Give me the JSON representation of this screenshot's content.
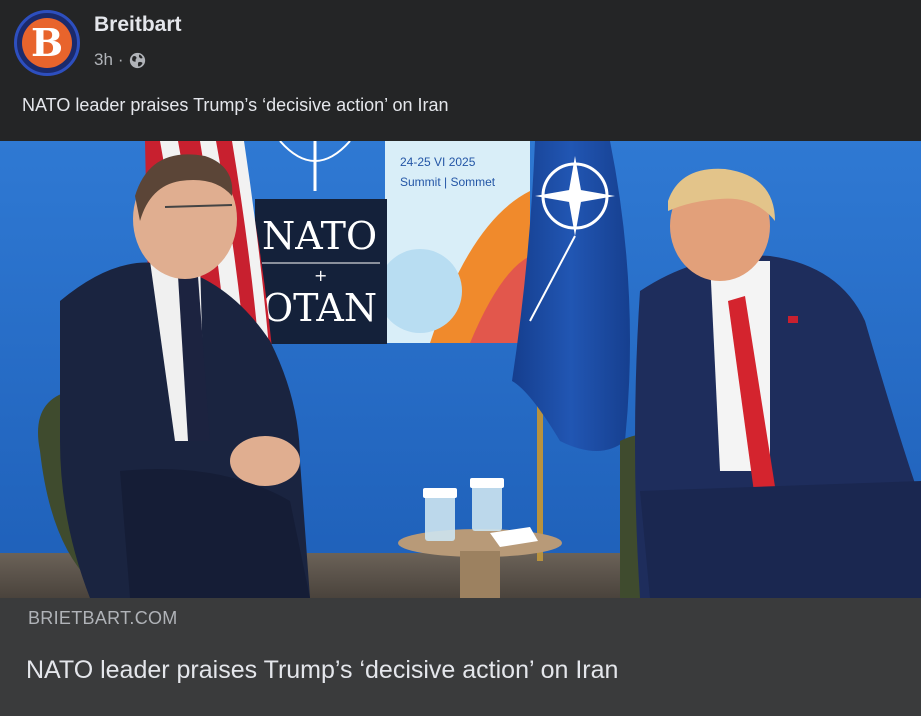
{
  "post": {
    "page_name": "Breitbart",
    "avatar_letter": "B",
    "time": "3h",
    "separator": "·",
    "audience_icon": "globe-icon",
    "caption": "NATO leader praises Trump’s ‘decisive action’ on Iran"
  },
  "photo": {
    "backdrop_text": {
      "dates": "24-25 VI 2025",
      "summit": "Summit | Sommet",
      "nato": "NATO",
      "otan": "OTAN",
      "plus": "+"
    }
  },
  "link_preview": {
    "domain": "BRIETBART.COM",
    "title": "NATO leader praises Trump’s ‘decisive action’ on Iran"
  },
  "colors": {
    "background": "#242526",
    "link_box": "#3a3b3c",
    "avatar_orange": "#e8642c",
    "avatar_navy": "#1b2a6b",
    "nato_blue": "#1f5fbf"
  }
}
